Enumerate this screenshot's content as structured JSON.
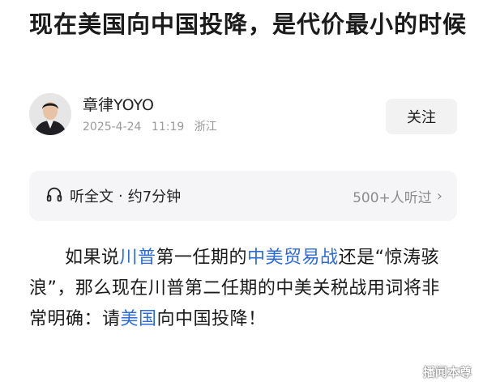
{
  "article": {
    "title": "现在美国向中国投降，是代价最小的时候"
  },
  "author": {
    "name": "章律YOYO",
    "date": "2025-4-24",
    "time": "11:19",
    "location": "浙江",
    "follow_label": "关注"
  },
  "listen": {
    "label": "听全文",
    "separator": "·",
    "duration": "约7分钟",
    "listeners": "500+人听过",
    "chevron": "›"
  },
  "body": {
    "p1_a": "如果说",
    "p1_link1": "川普",
    "p1_b": "第一任期的",
    "p1_link2": "中美贸易战",
    "p1_c": "还是“惊涛骇浪”，那么现在川普第二任期的中美关税战用词将非常明确：请",
    "p1_link3": "美国",
    "p1_d": "向中国投降！"
  },
  "watermark": "播闻本尊",
  "colors": {
    "link": "#2d6bd8",
    "meta": "#9a9a9a",
    "listen_bg": "#f5f5f7",
    "follow_bg": "#f2f2f2"
  },
  "icons": {
    "listen": "headphones-icon",
    "more": "chevron-right-icon"
  }
}
